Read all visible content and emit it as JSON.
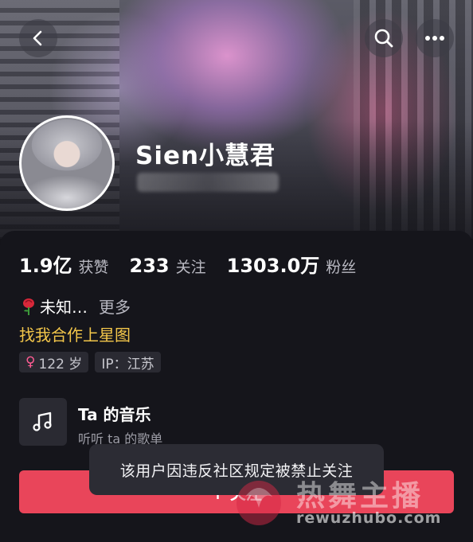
{
  "header": {
    "back_icon": "chevron-left-icon",
    "search_icon": "search-icon",
    "more_icon": "more-horizontal-icon"
  },
  "profile": {
    "username": "Sien小慧君"
  },
  "stats": [
    {
      "value": "1.9亿",
      "label": "获赞"
    },
    {
      "value": "233",
      "label": "关注"
    },
    {
      "value": "1303.0万",
      "label": "粉丝"
    }
  ],
  "bio": {
    "text": "未知…",
    "more": "更多",
    "cooperate": "找我合作上星图"
  },
  "tags": {
    "age": "122 岁",
    "ip": "IP：江苏"
  },
  "music": {
    "title": "Ta 的音乐",
    "subtitle": "听听 ta 的歌单"
  },
  "follow_button": {
    "label": "+ 关注"
  },
  "toast": {
    "message": "该用户因违反社区规定被禁止关注"
  },
  "watermark": {
    "title": "热舞主播",
    "url": "rewuzhubo.com"
  },
  "colors": {
    "follow": "#e9455a",
    "cooperate": "#f3c64a",
    "female": "#ff5c93"
  }
}
